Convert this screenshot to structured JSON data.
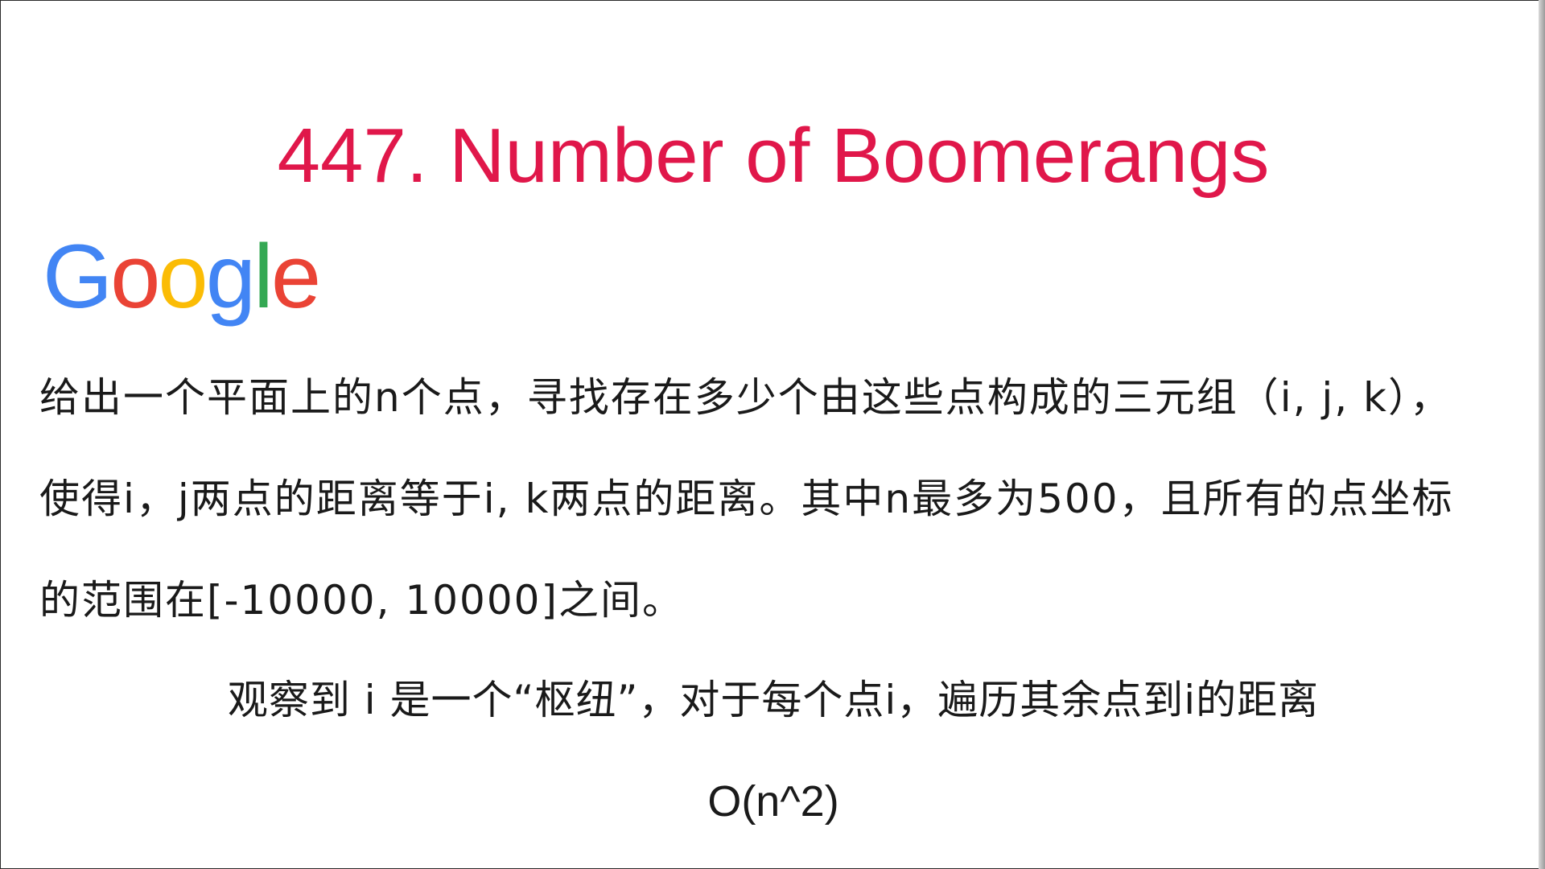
{
  "slide": {
    "title": "447. Number of Boomerangs",
    "logo": {
      "letters": [
        "G",
        "o",
        "o",
        "g",
        "l",
        "e"
      ],
      "colors": [
        "#4285f4",
        "#ea4335",
        "#fbbc05",
        "#4285f4",
        "#34a853",
        "#ea4335"
      ]
    },
    "problem_text": "给出一个平面上的n个点，寻找存在多少个由这些点构成的三元组（i, j, k），使得i，j两点的距离等于i, k两点的距离。其中n最多为500，且所有的点坐标的范围在[-10000, 10000]之间。",
    "insight_text": "观察到 i 是一个“枢纽”，对于每个点i，遍历其余点到i的距离",
    "complexity_text": "O(n^2)"
  },
  "colors": {
    "title": "#e0174a",
    "text": "#1a1a1a",
    "background": "#ffffff"
  }
}
